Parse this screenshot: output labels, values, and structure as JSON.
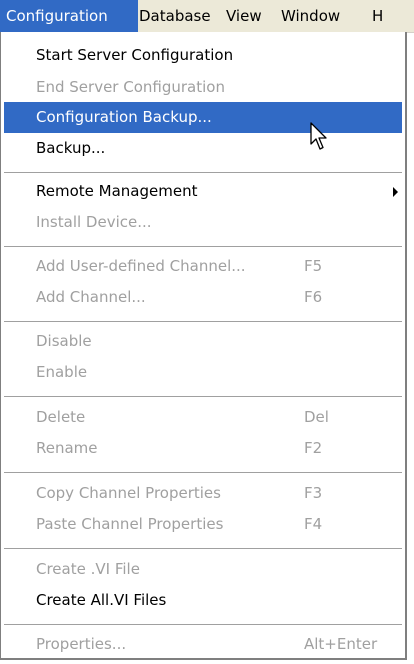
{
  "menubar": {
    "items": [
      {
        "label": "Configuration"
      },
      {
        "label": "Database"
      },
      {
        "label": "View"
      },
      {
        "label": "Window"
      },
      {
        "label": "H"
      }
    ]
  },
  "menu": {
    "items": [
      {
        "label": "Start Server Configuration",
        "shortcut": "",
        "state": "enabled"
      },
      {
        "label": "End Server Configuration",
        "shortcut": "",
        "state": "disabled"
      },
      {
        "label": "Configuration Backup...",
        "shortcut": "",
        "state": "highlighted"
      },
      {
        "label": "Backup...",
        "shortcut": "",
        "state": "enabled"
      },
      {
        "label": "Remote Management",
        "shortcut": "",
        "state": "enabled",
        "submenu": true
      },
      {
        "label": "Install Device...",
        "shortcut": "",
        "state": "disabled"
      },
      {
        "label": "Add User-defined Channel...",
        "shortcut": "F5",
        "state": "disabled"
      },
      {
        "label": "Add Channel...",
        "shortcut": "F6",
        "state": "disabled"
      },
      {
        "label": "Disable",
        "shortcut": "",
        "state": "disabled"
      },
      {
        "label": "Enable",
        "shortcut": "",
        "state": "disabled"
      },
      {
        "label": "Delete",
        "shortcut": "Del",
        "state": "disabled"
      },
      {
        "label": "Rename",
        "shortcut": "F2",
        "state": "disabled"
      },
      {
        "label": "Copy Channel Properties",
        "shortcut": "F3",
        "state": "disabled"
      },
      {
        "label": "Paste Channel Properties",
        "shortcut": "F4",
        "state": "disabled"
      },
      {
        "label": "Create .VI File",
        "shortcut": "",
        "state": "disabled"
      },
      {
        "label": "Create All.VI Files",
        "shortcut": "",
        "state": "enabled"
      },
      {
        "label": "Properties...",
        "shortcut": "Alt+Enter",
        "state": "disabled"
      }
    ]
  },
  "colors": {
    "highlight": "#316ac5",
    "disabled_text": "#a0a0a0",
    "menubar_bg": "#ece9d8"
  },
  "icons": {
    "cursor": "arrow-cursor-icon",
    "submenu": "submenu-arrow-icon"
  }
}
